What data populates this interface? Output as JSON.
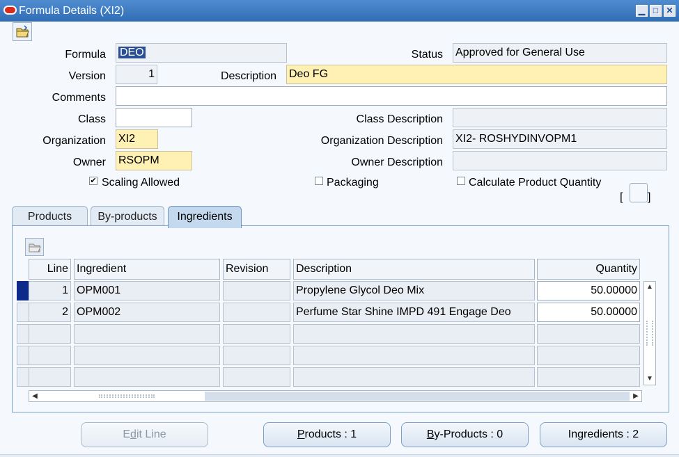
{
  "window": {
    "title": "Formula Details (XI2)",
    "controls": [
      "minimize-icon",
      "maximize-icon",
      "close-icon"
    ]
  },
  "form": {
    "formula_label": "Formula",
    "formula_value": "DEO",
    "status_label": "Status",
    "status_value": "Approved for General Use",
    "version_label": "Version",
    "version_value": "1",
    "description_label": "Description",
    "description_value": "Deo  FG",
    "comments_label": "Comments",
    "comments_value": "",
    "class_label": "Class",
    "class_value": "",
    "class_description_label": "Class Description",
    "class_description_value": "",
    "organization_label": "Organization",
    "organization_value": "XI2",
    "organization_description_label": "Organization Description",
    "organization_description_value": "XI2- ROSHYDINVOPM1",
    "owner_label": "Owner",
    "owner_value": "RSOPM",
    "owner_description_label": "Owner Description",
    "owner_description_value": "",
    "scaling_allowed_label": "Scaling Allowed",
    "scaling_allowed_checked": true,
    "packaging_label": "Packaging",
    "packaging_checked": false,
    "calculate_product_quantity_label": "Calculate Product Quantity",
    "calculate_product_quantity_checked": false,
    "bracket_open": "[",
    "bracket_close": "]"
  },
  "tabs": [
    {
      "label": "Products",
      "active": false
    },
    {
      "label": "By-products",
      "active": false
    },
    {
      "label": "Ingredients",
      "active": true
    }
  ],
  "table": {
    "columns": [
      "Line",
      "Ingredient",
      "Revision",
      "Description",
      "Quantity"
    ],
    "rows": [
      {
        "line": "1",
        "ingredient": "OPM001",
        "revision": "",
        "description": "Propylene Glycol Deo Mix",
        "quantity": "50.00000"
      },
      {
        "line": "2",
        "ingredient": "OPM002",
        "revision": "",
        "description": "Perfume Star Shine IMPD 491 Engage Deo",
        "quantity": "50.00000"
      },
      {
        "line": "",
        "ingredient": "",
        "revision": "",
        "description": "",
        "quantity": ""
      },
      {
        "line": "",
        "ingredient": "",
        "revision": "",
        "description": "",
        "quantity": ""
      },
      {
        "line": "",
        "ingredient": "",
        "revision": "",
        "description": "",
        "quantity": ""
      }
    ]
  },
  "buttons": {
    "edit_line_prefix": "E",
    "edit_line_mnemonic": "d",
    "edit_line_rest": "it Line",
    "products_mnemonic": "P",
    "products_rest": "roducts : 1",
    "byproducts_mnemonic": "B",
    "byproducts_rest": "y-Products : 0",
    "ingredients": "Ingredients : 2"
  },
  "colors": {
    "titlebar": "#2f6db5",
    "required_field": "#fff0b4",
    "selected_row_indicator": "#0d2a8a",
    "active_tab": "#c4d8ee"
  }
}
